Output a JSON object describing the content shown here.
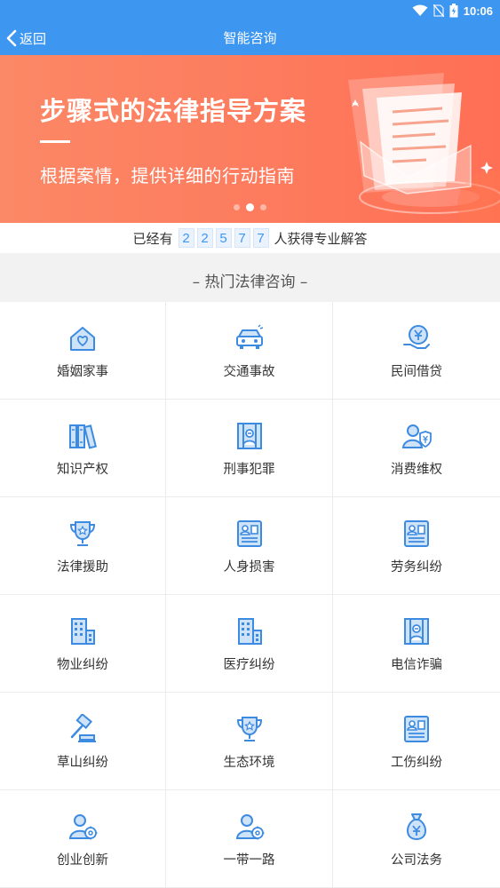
{
  "status_bar": {
    "time": "10:06"
  },
  "nav": {
    "back_label": "返回",
    "title": "智能咨询"
  },
  "banner": {
    "headline": "步骤式的法律指导方案",
    "subline": "根据案情，提供详细的行动指南",
    "pagination": {
      "pages": 3,
      "active_index": 1
    }
  },
  "counter": {
    "prefix": "已经有",
    "digits": [
      "2",
      "2",
      "5",
      "7",
      "7"
    ],
    "suffix": "人获得专业解答"
  },
  "section": {
    "title": "– 热门法律咨询 –"
  },
  "categories": [
    {
      "label": "婚姻家事",
      "icon": "house-heart-icon"
    },
    {
      "label": "交通事故",
      "icon": "car-icon"
    },
    {
      "label": "民间借贷",
      "icon": "money-hand-icon"
    },
    {
      "label": "知识产权",
      "icon": "books-icon"
    },
    {
      "label": "刑事犯罪",
      "icon": "prisoner-icon"
    },
    {
      "label": "消费维权",
      "icon": "person-shield-icon"
    },
    {
      "label": "法律援助",
      "icon": "trophy-icon"
    },
    {
      "label": "人身损害",
      "icon": "id-card-icon"
    },
    {
      "label": "劳务纠纷",
      "icon": "id-card-icon"
    },
    {
      "label": "物业纠纷",
      "icon": "building-icon"
    },
    {
      "label": "医疗纠纷",
      "icon": "building-icon"
    },
    {
      "label": "电信诈骗",
      "icon": "prisoner-icon"
    },
    {
      "label": "草山纠纷",
      "icon": "gavel-icon"
    },
    {
      "label": "生态环境",
      "icon": "trophy-icon"
    },
    {
      "label": "工伤纠纷",
      "icon": "id-card-icon"
    },
    {
      "label": "创业创新",
      "icon": "person-gear-icon"
    },
    {
      "label": "一带一路",
      "icon": "person-gear-icon"
    },
    {
      "label": "公司法务",
      "icon": "money-bag-icon"
    }
  ],
  "colors": {
    "primary": "#3d97f0",
    "banner": "#fd7b5e",
    "icon_blue": "#3d8be0"
  }
}
